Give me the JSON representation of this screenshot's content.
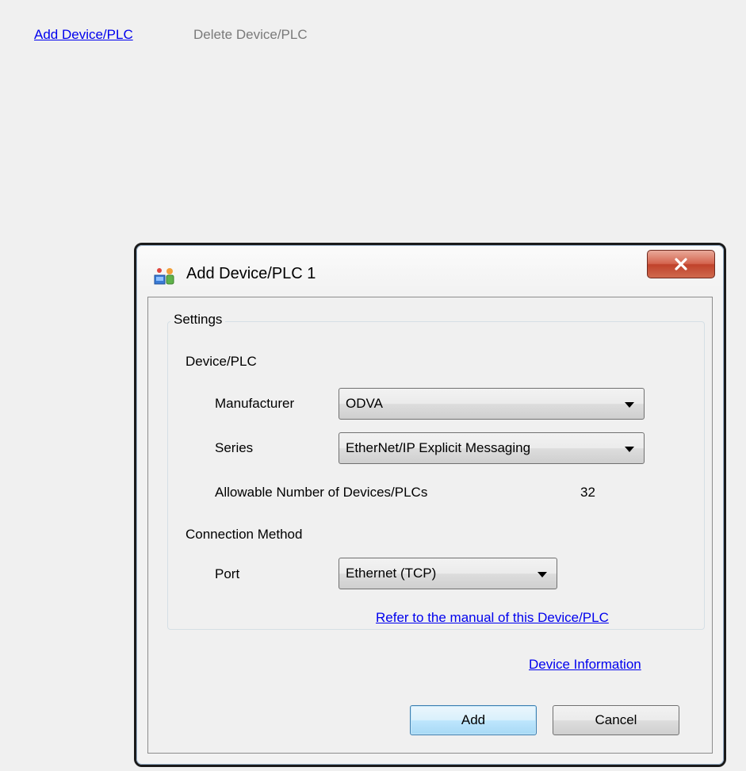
{
  "toolbar": {
    "add_label": "Add Device/PLC",
    "delete_label": "Delete Device/PLC"
  },
  "dialog": {
    "title": "Add Device/PLC 1",
    "close_glyph": "X",
    "settings_legend": "Settings",
    "device_section": "Device/PLC",
    "manufacturer_label": "Manufacturer",
    "manufacturer_value": "ODVA",
    "series_label": "Series",
    "series_value": "EtherNet/IP Explicit Messaging",
    "allowable_label": "Allowable Number of Devices/PLCs",
    "allowable_value": "32",
    "connection_section": "Connection Method",
    "port_label": "Port",
    "port_value": "Ethernet (TCP)",
    "manual_link": "Refer to the manual of this Device/PLC",
    "device_info_link": "Device Information",
    "add_button": "Add",
    "cancel_button": "Cancel"
  }
}
